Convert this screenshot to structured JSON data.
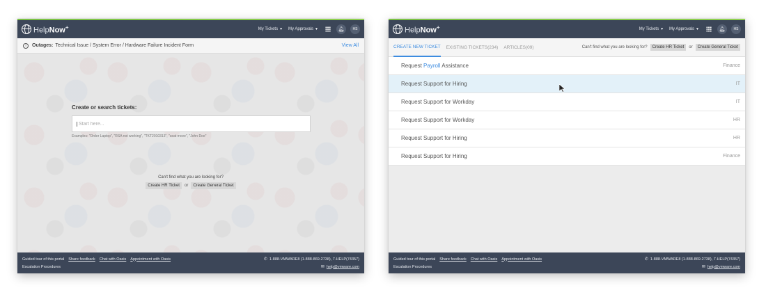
{
  "left": {
    "logo": {
      "prefix": "Help",
      "bold": "Now",
      "sup": "+"
    },
    "nav": {
      "my_tickets": "My Tickets",
      "my_approvals": "My Approvals",
      "avatar": "HS"
    },
    "outage": {
      "label": "Outages:",
      "text": "Technical Issue / System Error / Hardware Failure Incident Form",
      "view_all": "View All"
    },
    "hero": {
      "title": "Create or search tickets:",
      "placeholder": "Start here...",
      "examples": "Examples: \"Order Laptop\", \"RSA not working\", \"TKT2010313\", \"seat move\", \"John Doe\"",
      "cant_find": "Can't find what you are looking for?",
      "btn_hr": "Create HR Ticket",
      "or": "or",
      "btn_general": "Create General Ticket"
    },
    "footer": {
      "links": [
        "Guided tour of this portal",
        "Share feedback",
        "Chat with Oasis",
        "Appointment with Oasis"
      ],
      "escalation": "Escalation Procedures",
      "phone": "1-888-VMWARE8 (1-888-869-2738), 7-HELP(74357)",
      "email": "help@vmware.com"
    }
  },
  "right": {
    "logo": {
      "prefix": "Help",
      "bold": "Now",
      "sup": "+"
    },
    "nav": {
      "my_tickets": "My Tickets",
      "my_approvals": "My Approvals",
      "avatar": "HS"
    },
    "tabs": {
      "create": "CREATE NEW TICKET",
      "existing": "EXISTING TICKETS(234)",
      "articles": "ARTICLES(09)",
      "cant_find": "Can't find what you are looking for?",
      "btn_hr": "Create HR Ticket",
      "or": "or",
      "btn_general": "Create General Ticket"
    },
    "tickets": [
      {
        "pre": "Request ",
        "hl": "Payroll",
        "post": " Assistance",
        "dept": "Finance"
      },
      {
        "pre": "Request Support for Hiring",
        "hl": "",
        "post": "",
        "dept": "IT"
      },
      {
        "pre": "Request Support for Workday",
        "hl": "",
        "post": "",
        "dept": "IT"
      },
      {
        "pre": "Request Support for Workday",
        "hl": "",
        "post": "",
        "dept": "HR"
      },
      {
        "pre": "Request Support for Hiring",
        "hl": "",
        "post": "",
        "dept": "HR"
      },
      {
        "pre": "Request Support for Hiring",
        "hl": "",
        "post": "",
        "dept": "Finance"
      }
    ],
    "footer": {
      "links": [
        "Guided tour of this portal",
        "Share feedback",
        "Chat with Oasis",
        "Appointment with Oasis"
      ],
      "escalation": "Escalation Procedures",
      "phone": "1-888-VMWARE8 (1-888-869-2738), 7-HELP(74357)",
      "email": "help@vmware.com"
    }
  },
  "icons": {
    "logo": "globe-icon",
    "caret": "chevron-down-icon",
    "apps": "grid-icon",
    "notifications": "bell-icon",
    "info": "info-icon",
    "phone": "phone-icon",
    "mail": "mail-icon",
    "cursor": "mouse-pointer-icon"
  },
  "colors": {
    "topbar": "#3c4658",
    "accent": "#79c143",
    "link": "#3d8ce0",
    "hover_row": "#e3f1f9"
  }
}
